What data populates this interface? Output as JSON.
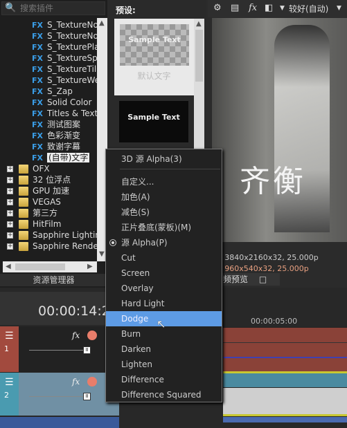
{
  "explorer": {
    "search_placeholder": "搜索插件",
    "tab": "资源管理器",
    "fx_items": [
      "S_TextureNo",
      "S_TextureNo",
      "S_TexturePla",
      "S_TextureSp",
      "S_TextureTil",
      "S_TextureWe",
      "S_Zap",
      "Solid Color",
      "Titles & Text",
      "测试图案",
      "色彩渐变",
      "致谢字幕",
      "(自带)文字"
    ],
    "selected_fx": "(自带)文字",
    "folders": [
      "OFX",
      "32 位浮点",
      "GPU 加速",
      "VEGAS",
      "第三方",
      "HitFilm",
      "Sapphire Lightin",
      "Sapphire Rende"
    ]
  },
  "presets": {
    "header": "预设:",
    "items": [
      {
        "sample": "Sample Text",
        "label": "默认文字"
      },
      {
        "sample": "Sample Text",
        "label": ""
      }
    ]
  },
  "preview": {
    "quality": "较好(自动)",
    "project_label": "目:",
    "project_value": "3840x2160x32, 25.000p",
    "preview_label": "览:",
    "preview_value": "960x540x32, 25.000p",
    "overlay_text": "齐衡",
    "tab": "频预览",
    "preview_value_color": "#e8a080"
  },
  "timeline": {
    "timecode": "00:00:14:2",
    "ruler_label": "00:00:05:00",
    "tracks": [
      {
        "number": "1",
        "color": "#a24a3e"
      },
      {
        "number": "2",
        "color": "#4a9bb0"
      }
    ]
  },
  "menu": {
    "items": [
      "3D 源 Alpha(3)",
      "自定义...",
      "加色(A)",
      "减色(S)",
      "正片叠底(蒙板)(M)",
      "源 Alpha(P)",
      "Cut",
      "Screen",
      "Overlay",
      "Hard Light",
      "Dodge",
      "Burn",
      "Darken",
      "Lighten",
      "Difference",
      "Difference Squared"
    ],
    "checked": "源 Alpha(P)",
    "highlighted": "Dodge",
    "highlight_color": "#5d9be5"
  }
}
